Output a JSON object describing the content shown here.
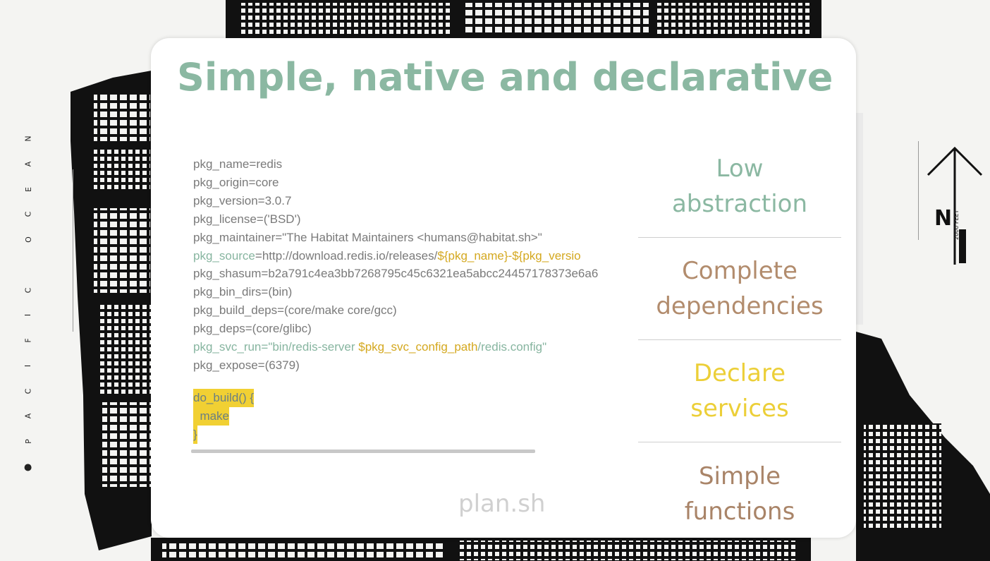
{
  "slide": {
    "title": "Simple, native and declarative",
    "file_label": "plan.sh"
  },
  "code": {
    "lines": [
      {
        "plain": "pkg_name=redis"
      },
      {
        "plain": "pkg_origin=core"
      },
      {
        "plain": "pkg_version=3.0.7"
      },
      {
        "plain": "pkg_license=('BSD')"
      },
      {
        "plain": "pkg_maintainer=\"The Habitat Maintainers <humans@habitat.sh>\""
      },
      {
        "a": "pkg_source",
        "b": "=http://download.redis.io/releases/",
        "c": "${pkg_name}-${pkg_versio"
      },
      {
        "plain": "pkg_shasum=b2a791c4ea3bb7268795c45c6321ea5abcc24457178373e6a6"
      },
      {
        "plain": "pkg_bin_dirs=(bin)"
      },
      {
        "plain": "pkg_build_deps=(core/make core/gcc)"
      },
      {
        "plain": "pkg_deps=(core/glibc)"
      },
      {
        "a": "pkg_svc_run=\"bin/redis-server ",
        "c": "$pkg_svc_config_path",
        "b": "/redis.config\""
      },
      {
        "plain": "pkg_expose=(6379)"
      }
    ],
    "fn_lines": [
      "do_build() {",
      "  make",
      "}"
    ]
  },
  "features": [
    {
      "label": "Low\nabstraction",
      "color": "#8bb8a2"
    },
    {
      "label": "Complete\ndependencies",
      "color": "#b28c6d"
    },
    {
      "label": "Declare\nservices",
      "color": "#eccf38"
    },
    {
      "label": "Simple\nfunctions",
      "color": "#a98468"
    }
  ],
  "background": {
    "side_text": "PACIFIC OCEAN",
    "compass_letter": "N",
    "scale_text": "2000 FEET"
  }
}
